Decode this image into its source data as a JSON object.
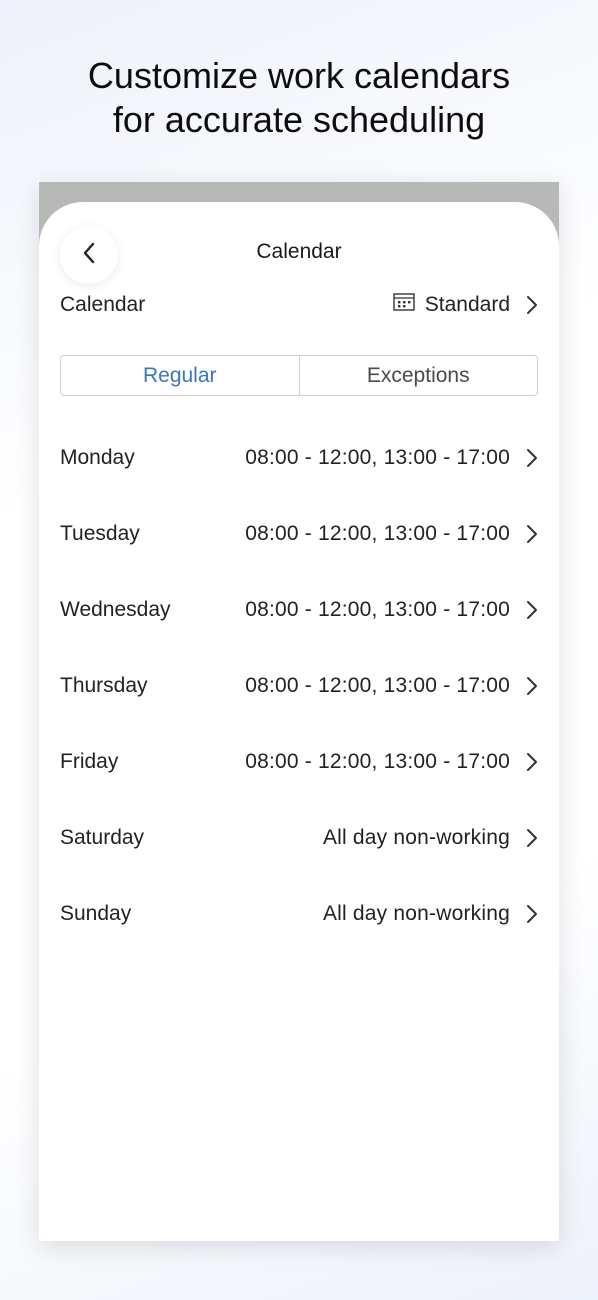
{
  "promo": {
    "headline_line1": "Customize work calendars",
    "headline_line2": "for accurate scheduling"
  },
  "header": {
    "title": "Calendar"
  },
  "calendar_selector": {
    "label": "Calendar",
    "value": "Standard"
  },
  "tabs": [
    {
      "label": "Regular",
      "active": true
    },
    {
      "label": "Exceptions",
      "active": false
    }
  ],
  "days": [
    {
      "name": "Monday",
      "hours": "08:00 - 12:00, 13:00 - 17:00"
    },
    {
      "name": "Tuesday",
      "hours": "08:00 - 12:00, 13:00 - 17:00"
    },
    {
      "name": "Wednesday",
      "hours": "08:00 - 12:00, 13:00 - 17:00"
    },
    {
      "name": "Thursday",
      "hours": "08:00 - 12:00, 13:00 - 17:00"
    },
    {
      "name": "Friday",
      "hours": "08:00 - 12:00, 13:00 - 17:00"
    },
    {
      "name": "Saturday",
      "hours": "All day non-working"
    },
    {
      "name": "Sunday",
      "hours": "All day non-working"
    }
  ],
  "colors": {
    "accent": "#3a77b8",
    "text": "#222222",
    "device_frame": "#b7b9b7"
  },
  "icons": {
    "back": "chevron-left-icon",
    "calendar": "calendar-grid-icon",
    "row_chevron": "chevron-right-icon"
  }
}
